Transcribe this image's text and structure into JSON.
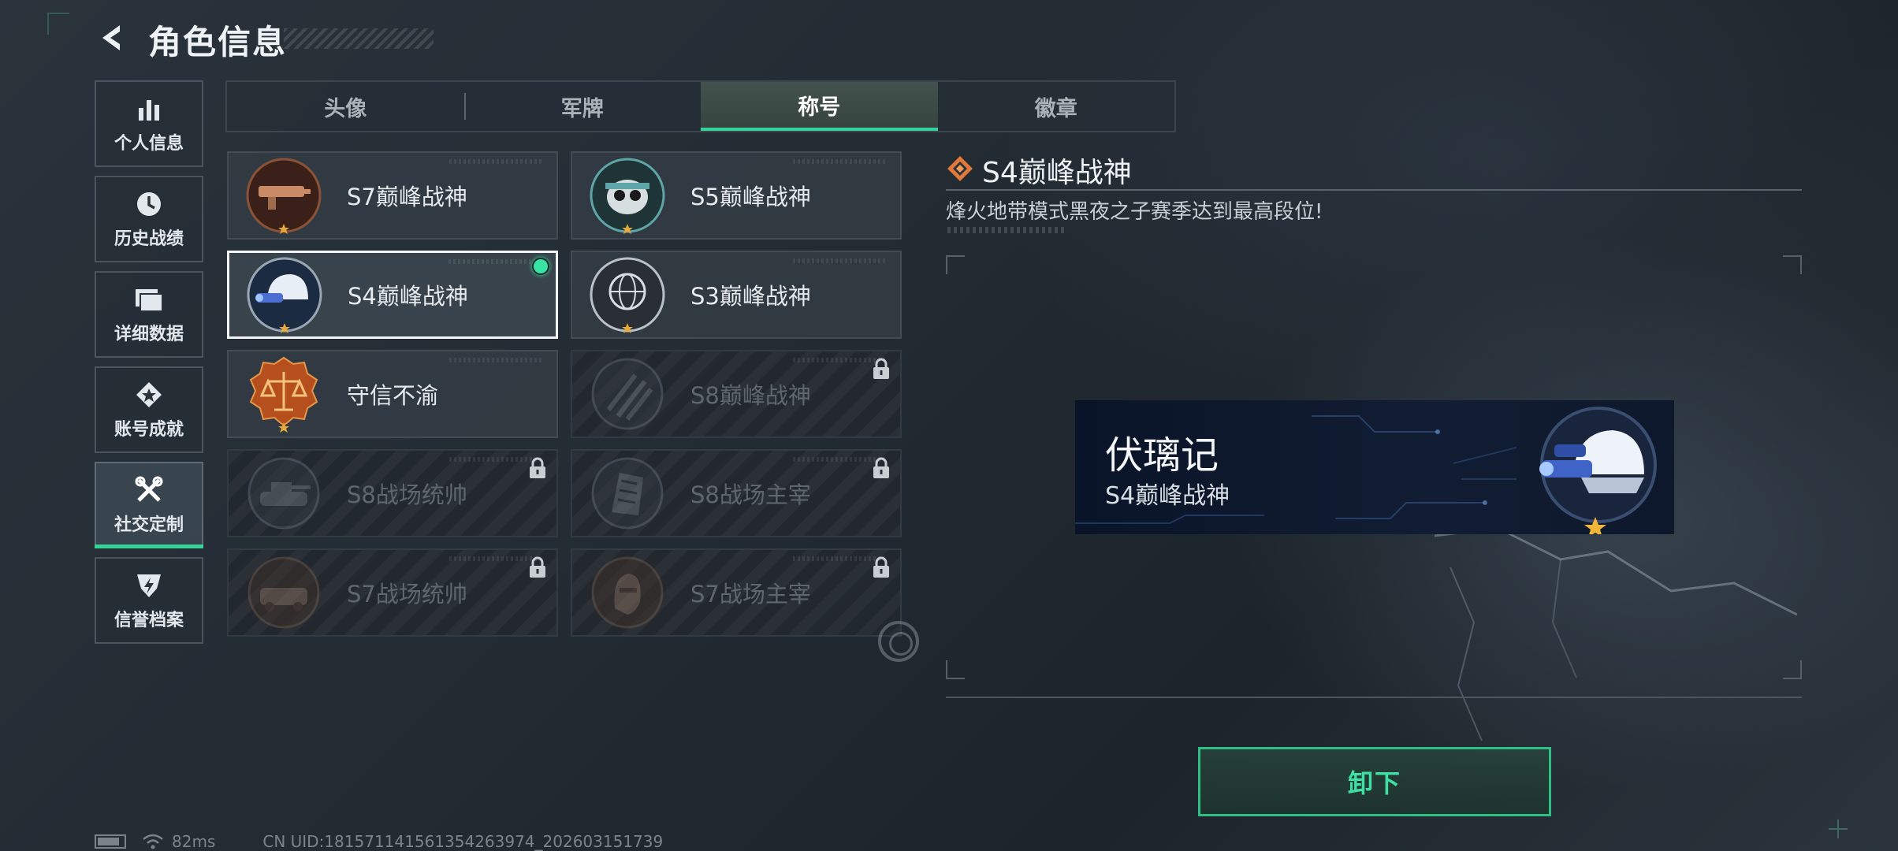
{
  "header": {
    "title": "角色信息",
    "back_icon": "back-arrow-icon"
  },
  "sidebar": {
    "items": [
      {
        "label": "个人信息",
        "icon": "bar-chart-icon",
        "active": false
      },
      {
        "label": "历史战绩",
        "icon": "clock-icon",
        "active": false
      },
      {
        "label": "详细数据",
        "icon": "folder-icon",
        "active": false
      },
      {
        "label": "账号成就",
        "icon": "achievement-icon",
        "active": false
      },
      {
        "label": "社交定制",
        "icon": "wrench-tools-icon",
        "active": true
      },
      {
        "label": "信誉档案",
        "icon": "credit-shield-icon",
        "active": false
      }
    ]
  },
  "tabs": [
    {
      "label": "头像",
      "active": false
    },
    {
      "label": "军牌",
      "active": false
    },
    {
      "label": "称号",
      "active": true
    },
    {
      "label": "徽章",
      "active": false
    }
  ],
  "titles": [
    {
      "label": "S7巅峰战神",
      "locked": false,
      "selected": false,
      "equipped": false
    },
    {
      "label": "S5巅峰战神",
      "locked": false,
      "selected": false,
      "equipped": false
    },
    {
      "label": "S4巅峰战神",
      "locked": false,
      "selected": true,
      "equipped": true
    },
    {
      "label": "S3巅峰战神",
      "locked": false,
      "selected": false,
      "equipped": false
    },
    {
      "label": "守信不渝",
      "locked": false,
      "selected": false,
      "equipped": false
    },
    {
      "label": "S8巅峰战神",
      "locked": true,
      "selected": false,
      "equipped": false
    },
    {
      "label": "S8战场统帅",
      "locked": true,
      "selected": false,
      "equipped": false
    },
    {
      "label": "S8战场主宰",
      "locked": true,
      "selected": false,
      "equipped": false
    },
    {
      "label": "S7战场统帅",
      "locked": true,
      "selected": false,
      "equipped": false
    },
    {
      "label": "S7战场主宰",
      "locked": true,
      "selected": false,
      "equipped": false
    }
  ],
  "detail": {
    "title": "S4巅峰战神",
    "description": "烽火地带模式黑夜之子赛季达到最高段位!",
    "banner_name": "伏璃记",
    "banner_title": "S4巅峰战神",
    "action_label": "卸下"
  },
  "status_bar": {
    "ping": "82ms",
    "uid": "CN UID:1815711415613542639​74_202603151739"
  },
  "colors": {
    "accent": "#35d39a",
    "diamond": "#e0783a",
    "banner_bg": "#0d1629"
  }
}
